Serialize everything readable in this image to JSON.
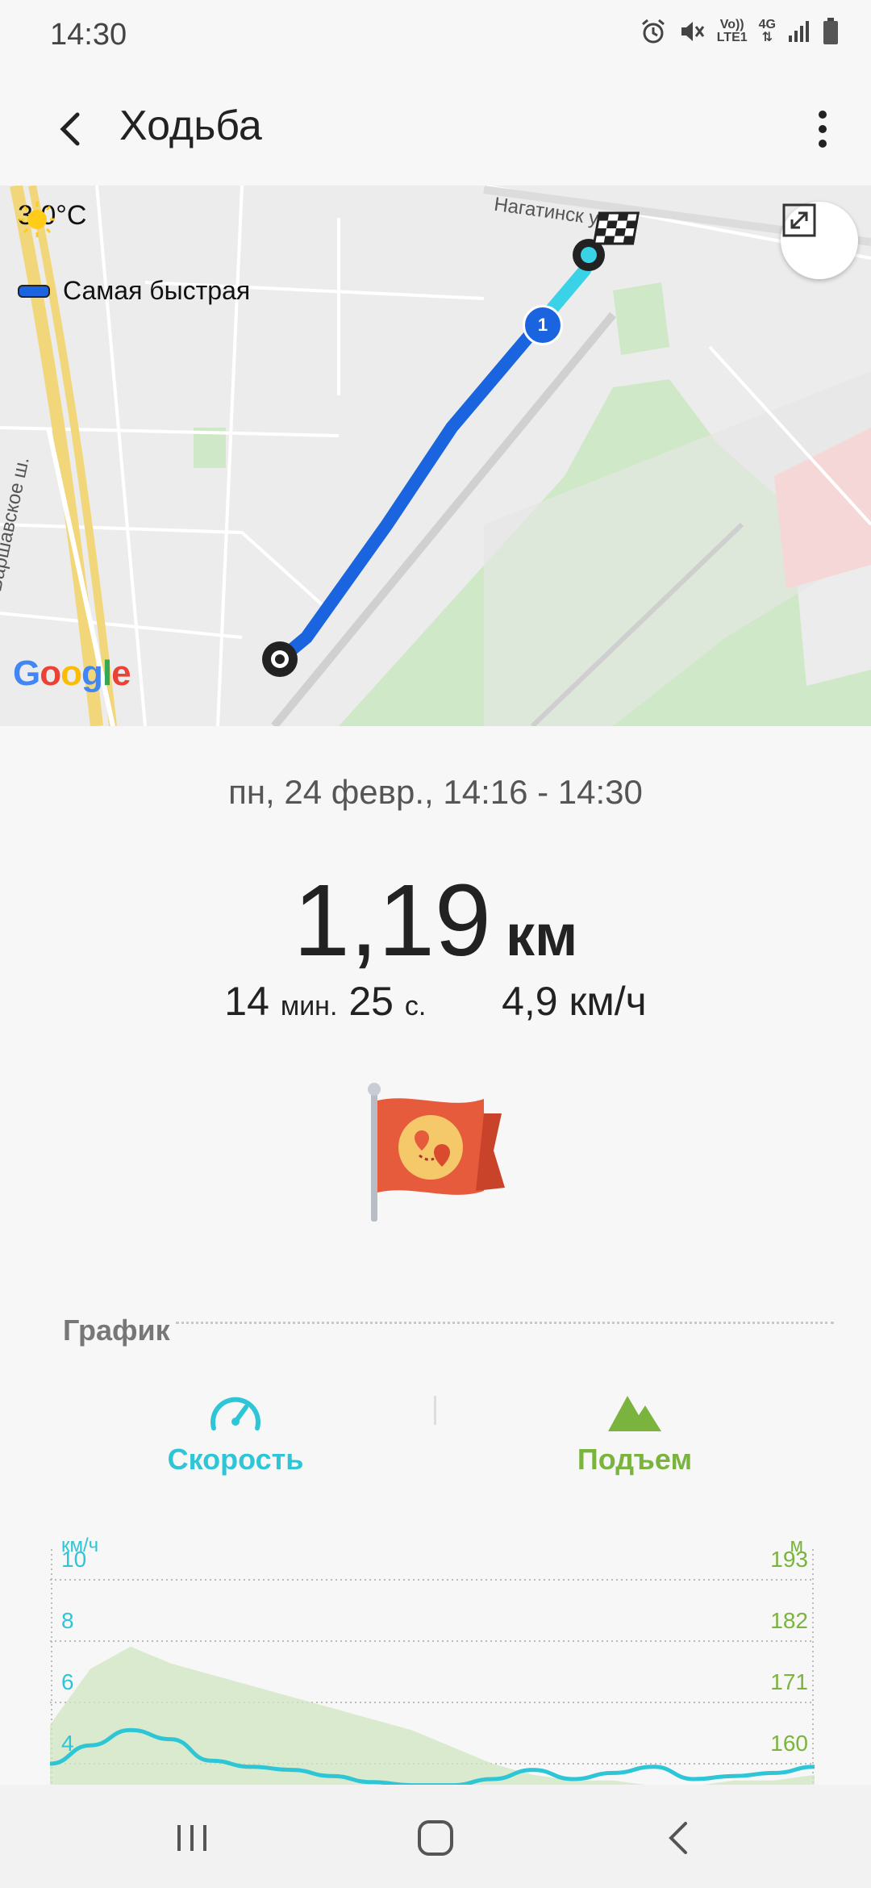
{
  "status_bar": {
    "time": "14:30",
    "net_top": "Vo))",
    "net_bottom": "LTE1",
    "gen_top": "4G",
    "gen_bottom": "⇅"
  },
  "app_bar": {
    "title": "Ходьба",
    "back_icon": "arrow-back-icon",
    "more_icon": "more-vert-icon"
  },
  "map": {
    "temperature": "3,0°C",
    "route_label": "Самая быстрая",
    "street_name": "Нагатинск",
    "street_suffix": "ул.",
    "road_name": "Варшавское ш.",
    "waypoint_number": "1",
    "provider": "Google",
    "colors": {
      "route": "#1a64e0",
      "route_end": "#39d2e6",
      "park": "#cfe9c8"
    }
  },
  "summary": {
    "datetime": "пн, 24 февр., 14:16 - 14:30",
    "distance_value": "1,19",
    "distance_unit": "км",
    "duration_min": "14",
    "duration_min_unit": "мин.",
    "duration_sec": "25",
    "duration_sec_unit": "с.",
    "speed": "4,9 км/ч"
  },
  "chart_section": {
    "title": "График",
    "tabs": [
      {
        "label": "Скорость",
        "icon": "speedometer-icon",
        "color": "#2ec6d6"
      },
      {
        "label": "Подъем",
        "icon": "mountain-icon",
        "color": "#7ab43e"
      }
    ]
  },
  "chart_data": {
    "type": "line",
    "left_axis": {
      "unit": "км/ч",
      "ticks": [
        "10",
        "8",
        "6",
        "4"
      ],
      "range": [
        4,
        10
      ]
    },
    "right_axis": {
      "unit": "м",
      "ticks": [
        "193",
        "182",
        "171",
        "160"
      ],
      "range": [
        160,
        193
      ]
    },
    "series": [
      {
        "axis": "left",
        "color": "#2ec6d6",
        "values": [
          4.0,
          4.6,
          5.1,
          4.8,
          4.1,
          3.9,
          3.8,
          3.6,
          3.4,
          3.3,
          3.3,
          3.5,
          3.8,
          3.5,
          3.7,
          3.9,
          3.5,
          3.6,
          3.7,
          3.9
        ]
      },
      {
        "axis": "right",
        "color": "#cfe6c0",
        "fill": true,
        "values": [
          167,
          177,
          181,
          178,
          176,
          174,
          172,
          170,
          168,
          166,
          163,
          160,
          158,
          157,
          157,
          156,
          156,
          157,
          157,
          158
        ]
      }
    ],
    "grid": true
  },
  "nav_bar": {
    "items": [
      "recent-apps-icon",
      "home-icon",
      "back-icon"
    ]
  }
}
